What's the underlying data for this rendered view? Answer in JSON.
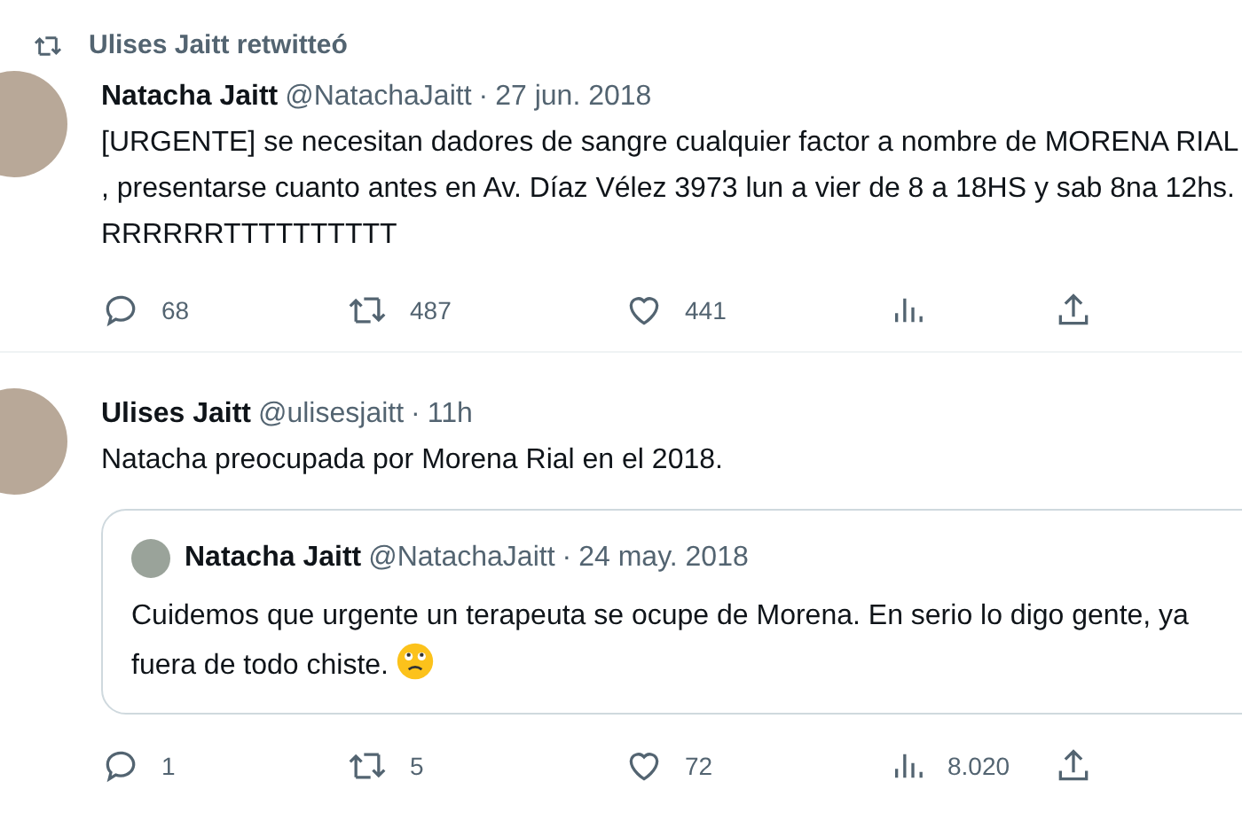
{
  "retweet_header": {
    "label": "Ulises Jaitt retwitteó"
  },
  "tweets": [
    {
      "name": "Natacha Jaitt",
      "handle": "@NatachaJaitt",
      "separator": "·",
      "time": "27 jun. 2018",
      "text": "[URGENTE] se necesitan dadores de sangre cualquier factor a nombre de MORENA RIAL , presentarse cuanto antes en Av. Díaz Vélez 3973 lun a vier de 8 a 18HS y sab 8na 12hs. RRRRRRTTTTTTTTTT",
      "actions": [
        {
          "kind": "reply",
          "count": "68"
        },
        {
          "kind": "retweet",
          "count": "487"
        },
        {
          "kind": "like",
          "count": "441"
        },
        {
          "kind": "views"
        },
        {
          "kind": "share"
        }
      ]
    },
    {
      "name": "Ulises Jaitt",
      "handle": "@ulisesjaitt",
      "separator": "·",
      "time": "11h",
      "text": "Natacha preocupada por Morena Rial en el 2018.",
      "quote": {
        "name": "Natacha Jaitt",
        "handle": "@NatachaJaitt",
        "separator": "·",
        "time": "24 may. 2018",
        "text": "Cuidemos que urgente un terapeuta se ocupe de Morena. En serio lo digo gente, ya fuera de todo chiste."
      },
      "actions": [
        {
          "kind": "reply",
          "count": "1"
        },
        {
          "kind": "retweet",
          "count": "5"
        },
        {
          "kind": "like",
          "count": "72"
        },
        {
          "kind": "views",
          "count": "8.020"
        },
        {
          "kind": "share"
        }
      ]
    }
  ]
}
